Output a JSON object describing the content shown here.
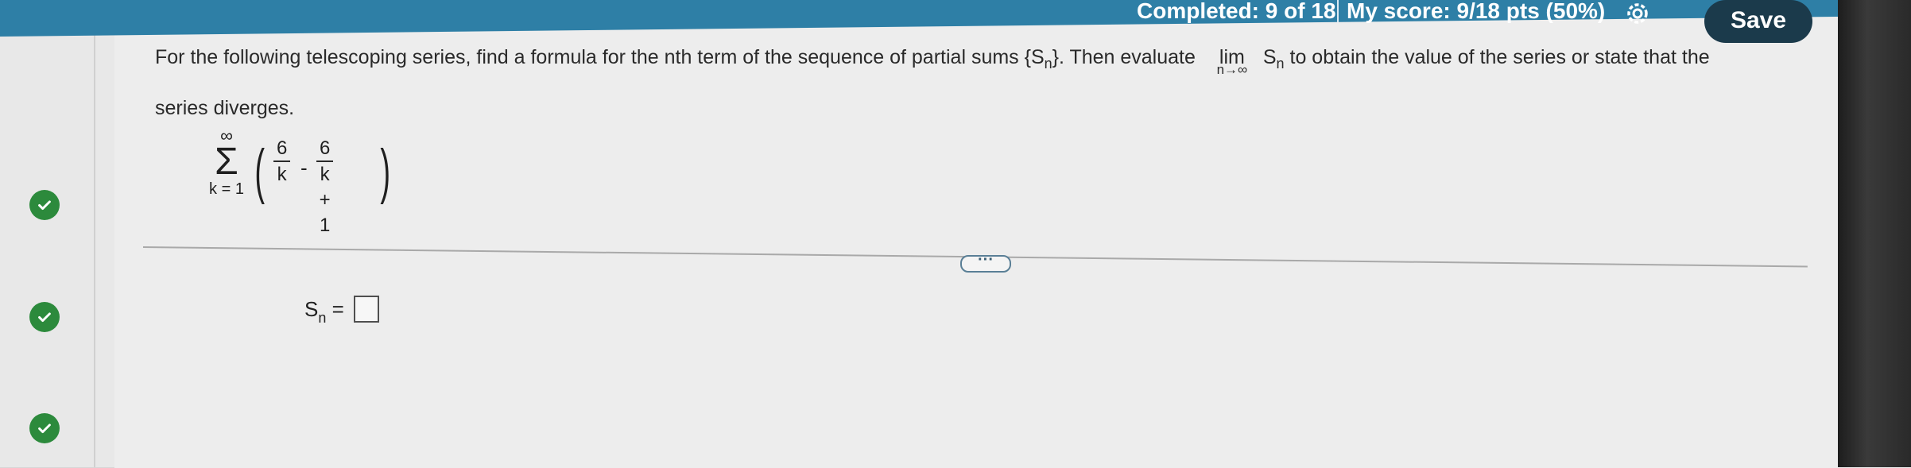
{
  "header": {
    "completed_text": "Completed: 9 of 18",
    "score_text": "My score: 9/18 pts (50%)",
    "save_label": "Save"
  },
  "question": {
    "text_part1": "For the following telescoping series, find a formula for the nth term of the sequence of partial sums {S",
    "sub_n": "n",
    "text_part2": "}. Then evaluate",
    "lim_label": "lim",
    "lim_S": "S",
    "lim_S_sub": "n",
    "lim_under": "n→∞",
    "text_part3": "to obtain the value of the series or state that the series diverges."
  },
  "series": {
    "upper": "∞",
    "sigma": "Σ",
    "lower": "k = 1",
    "frac1_num": "6",
    "frac1_den": "k",
    "minus": "-",
    "frac2_num": "6",
    "frac2_den": "k + 1"
  },
  "answer": {
    "label_S": "S",
    "label_sub": "n",
    "equals": " ="
  },
  "more_button": "···",
  "colors": {
    "header_bar": "#2e7fa6",
    "save_button": "#1b3a4b",
    "check_green": "#2c8a3c",
    "background": "#ededed"
  },
  "icons": {
    "settings": "gear-icon",
    "status": "checkmark-icon"
  }
}
